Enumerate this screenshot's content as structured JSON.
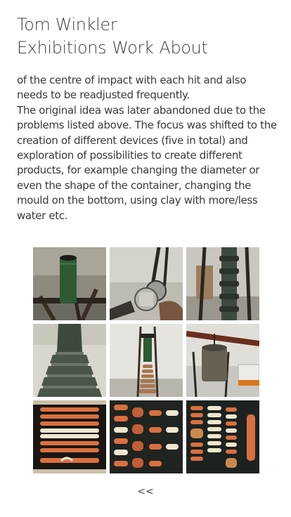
{
  "site": {
    "title": "Tom Winkler"
  },
  "nav": {
    "items": [
      {
        "label": "Exhibitions"
      },
      {
        "label": "Work"
      },
      {
        "label": "About"
      }
    ]
  },
  "article": {
    "paragraphs": [
      "of the centre of impact with each hit and also needs to be readjusted frequently.",
      "The original idea was later abandoned due to the problems listed above. The focus was shifted to the creation of different devices (five in total) and exploration of possibilities to create different products, for example changing the diameter or even the shape of the container, changing the mould on the bottom, using clay with more/less water etc."
    ]
  },
  "gallery": {
    "images": [
      {
        "icon": "green-pipe-tripod-photo"
      },
      {
        "icon": "hand-holding-mould-photo"
      },
      {
        "icon": "stacked-pipe-stand-photo"
      },
      {
        "icon": "extruded-clay-column-photo"
      },
      {
        "icon": "pipe-device-studio-photo"
      },
      {
        "icon": "hanging-container-railing-photo"
      },
      {
        "icon": "clay-pieces-dark-grid-photo"
      },
      {
        "icon": "clay-pieces-rows-photo"
      },
      {
        "icon": "clay-pieces-assorted-photo"
      }
    ]
  },
  "pagination": {
    "prev_label": "<<"
  },
  "colors": {
    "text": "#3a3a3a",
    "clay": "#d9703f",
    "cream": "#eee6cf",
    "green": "#2f5a34",
    "dark": "#141414"
  }
}
